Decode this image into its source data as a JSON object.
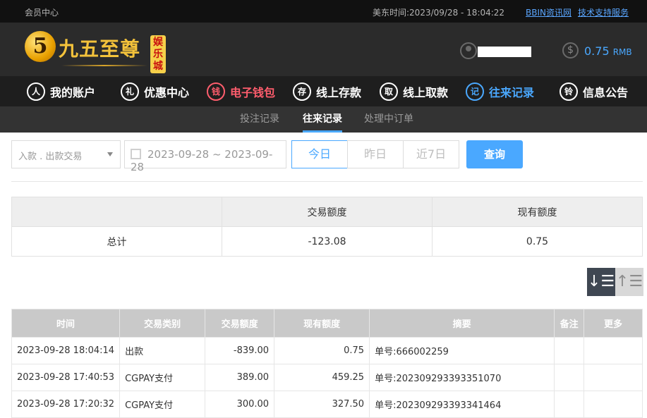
{
  "topbar": {
    "member_center": "会员中心",
    "eastern_time_label": "美东时间:",
    "eastern_time_value": "2023/09/28 - 18:04:22",
    "links": [
      "BBIN资讯网",
      "技术支持服务"
    ]
  },
  "header": {
    "logo_mark": "5",
    "logo_text": "九五至尊",
    "logo_badge": "娱乐城",
    "balance_amount": "0.75",
    "balance_currency": "RMB"
  },
  "nav": [
    {
      "label": "我的账户",
      "icon": "user-icon",
      "color": "#ffffff"
    },
    {
      "label": "优惠中心",
      "icon": "gift-icon",
      "color": "#ffffff"
    },
    {
      "label": "电子钱包",
      "icon": "wallet-icon",
      "color": "#ff5d6d"
    },
    {
      "label": "线上存款",
      "icon": "deposit-icon",
      "color": "#ffffff"
    },
    {
      "label": "线上取款",
      "icon": "withdraw-icon",
      "color": "#ffffff"
    },
    {
      "label": "往来记录",
      "icon": "record-icon",
      "color": "#4aa8ff"
    },
    {
      "label": "信息公告",
      "icon": "bell-icon",
      "color": "#ffffff"
    }
  ],
  "subtabs": [
    "投注记录",
    "往来记录",
    "处理中订单"
  ],
  "filters": {
    "transaction_type": "入款 . 出款交易",
    "date_range": "2023-09-28 ~ 2023-09-28",
    "range_buttons": [
      "今日",
      "昨日",
      "近7日"
    ],
    "query_label": "查询"
  },
  "summary": {
    "headers": [
      "",
      "交易额度",
      "现有额度"
    ],
    "row_label": "总计",
    "transaction_total": "-123.08",
    "current_total": "0.75"
  },
  "records": {
    "headers": [
      "时间",
      "交易类别",
      "交易额度",
      "现有额度",
      "摘要",
      "备注",
      "更多"
    ],
    "rows": [
      [
        "2023-09-28 18:04:14",
        "出款",
        "-839.00",
        "0.75",
        "单号:666002259",
        "",
        ""
      ],
      [
        "2023-09-28 17:40:53",
        "CGPAY支付",
        "389.00",
        "459.25",
        "单号:202309293393351070",
        "",
        ""
      ],
      [
        "2023-09-28 17:20:32",
        "CGPAY支付",
        "300.00",
        "327.50",
        "单号:202309293393341464",
        "",
        ""
      ]
    ]
  },
  "colors": {
    "accent": "#4aa8ff",
    "active_red": "#ff5d6d",
    "gold": "#f3c23b"
  }
}
